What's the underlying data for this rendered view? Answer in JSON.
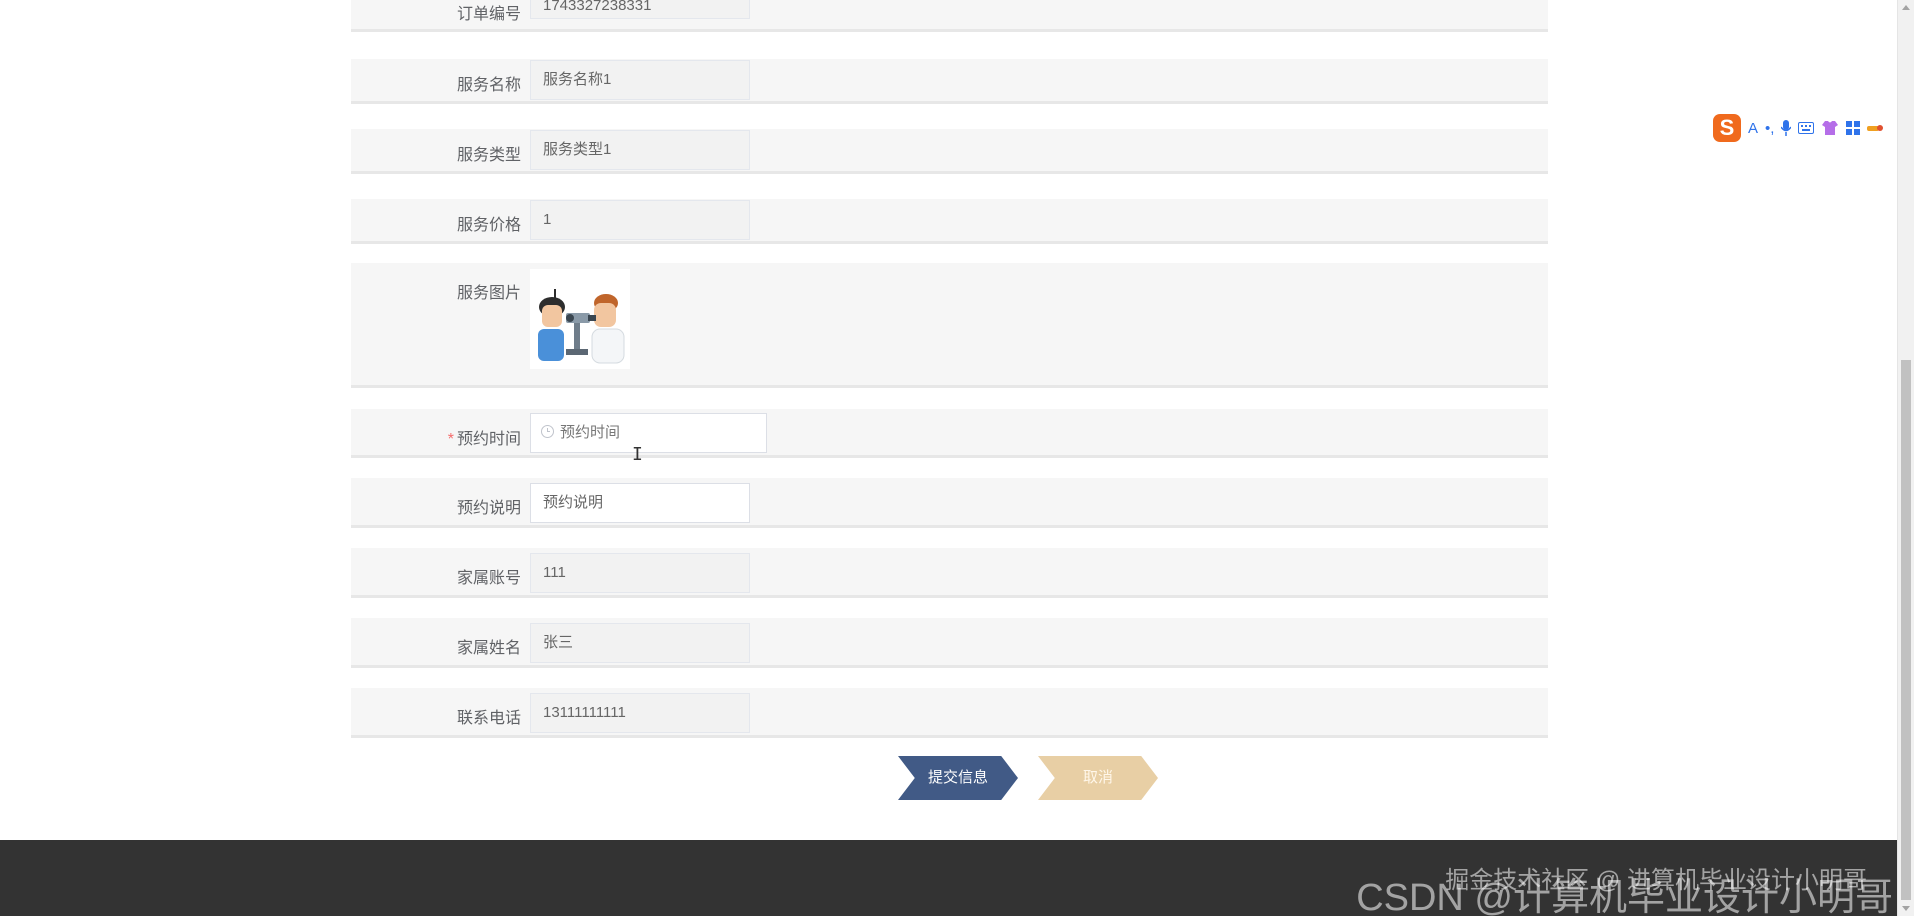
{
  "form": {
    "order_no": {
      "label": "订单编号",
      "value": "1743327238331"
    },
    "service_name": {
      "label": "服务名称",
      "value": "服务名称1"
    },
    "service_type": {
      "label": "服务类型",
      "value": "服务类型1"
    },
    "service_price": {
      "label": "服务价格",
      "value": "1"
    },
    "service_image": {
      "label": "服务图片"
    },
    "appointment_time": {
      "label": "预约时间",
      "required_mark": "*",
      "placeholder": "预约时间"
    },
    "appointment_note": {
      "label": "预约说明",
      "value": "预约说明"
    },
    "family_account": {
      "label": "家属账号",
      "value": "111"
    },
    "family_name": {
      "label": "家属姓名",
      "value": "张三"
    },
    "phone": {
      "label": "联系电话",
      "value": "13111111111"
    }
  },
  "buttons": {
    "submit": "提交信息",
    "cancel": "取消"
  },
  "footer": {
    "watermark_juejin": "掘金技术社区 @ 进算机毕业设计小明哥",
    "watermark_csdn": "CSDN @计算机毕业设计小明哥"
  },
  "ime_toolbar": {
    "logo": "S",
    "items": [
      "A",
      "•,",
      "mic-icon",
      "keyboard-icon",
      "shirt-icon",
      "grid-icon",
      "tools-icon"
    ]
  },
  "colors": {
    "submit_button": "#415a86",
    "cancel_button": "#e8cfa5",
    "footer": "#333333",
    "row_background": "#f6f6f6"
  }
}
